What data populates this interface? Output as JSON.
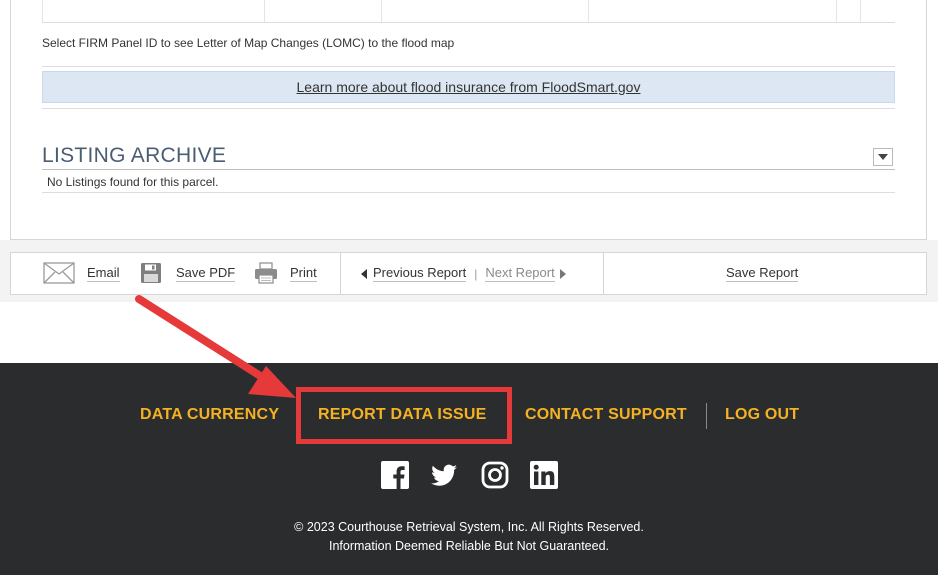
{
  "map_section": {
    "lomc_text": "Select FIRM Panel ID to see Letter of Map Changes (LOMC) to the flood map",
    "floodsmart_link": "Learn more about flood insurance from FloodSmart.gov"
  },
  "listing_archive": {
    "title": "LISTING ARCHIVE",
    "empty_text": "No Listings found for this parcel.",
    "toggle_icon": "chevron-down-icon"
  },
  "toolbar": {
    "email_label": "Email",
    "save_pdf_label": "Save PDF",
    "print_label": "Print",
    "previous_label": "Previous Report",
    "separator": "|",
    "next_label": "Next Report",
    "save_report_label": "Save Report"
  },
  "footer": {
    "nav": {
      "data_currency": "DATA CURRENCY",
      "report_data_issue": "REPORT DATA ISSUE",
      "contact_support": "CONTACT SUPPORT",
      "log_out": "LOG OUT"
    },
    "social_icons": [
      "facebook-icon",
      "twitter-icon",
      "instagram-icon",
      "linkedin-icon"
    ],
    "copyright_line1": "© 2023 Courthouse Retrieval System, Inc. All Rights Reserved.",
    "copyright_line2": "Information Deemed Reliable But Not Guaranteed."
  },
  "colors": {
    "footer_bg": "#2b2c2d",
    "footer_link": "#f4b223",
    "highlight": "#e63a3a",
    "banner_bg": "#dce7f3",
    "archive_title": "#4b5d73"
  }
}
